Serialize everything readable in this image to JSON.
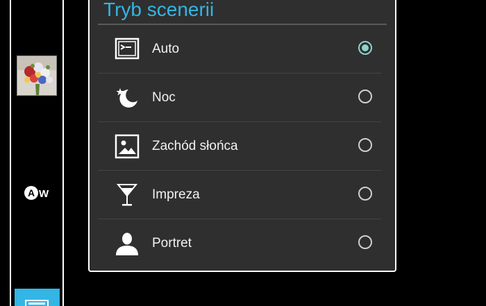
{
  "sidebar": {
    "thumbnail_icon": "flower-bouquet-thumbnail",
    "aw_badge_icon": "auto-white-balance-icon",
    "aw_badge_text": "A",
    "aw_badge_suffix": "W",
    "scene_button_icon": "scene-mode-icon"
  },
  "dialog": {
    "title": "Tryb scenerii",
    "options": [
      {
        "label": "Auto",
        "icon": "scene-auto-icon",
        "selected": true
      },
      {
        "label": "Noc",
        "icon": "moon-star-icon",
        "selected": false
      },
      {
        "label": "Zachód słońca",
        "icon": "landscape-picture-icon",
        "selected": false
      },
      {
        "label": "Impreza",
        "icon": "cocktail-glass-icon",
        "selected": false
      },
      {
        "label": "Portret",
        "icon": "person-silhouette-icon",
        "selected": false
      }
    ]
  },
  "colors": {
    "accent": "#33b5e5",
    "radio_selected": "#8fd3cc",
    "dialog_bg": "#2f2f2f"
  }
}
